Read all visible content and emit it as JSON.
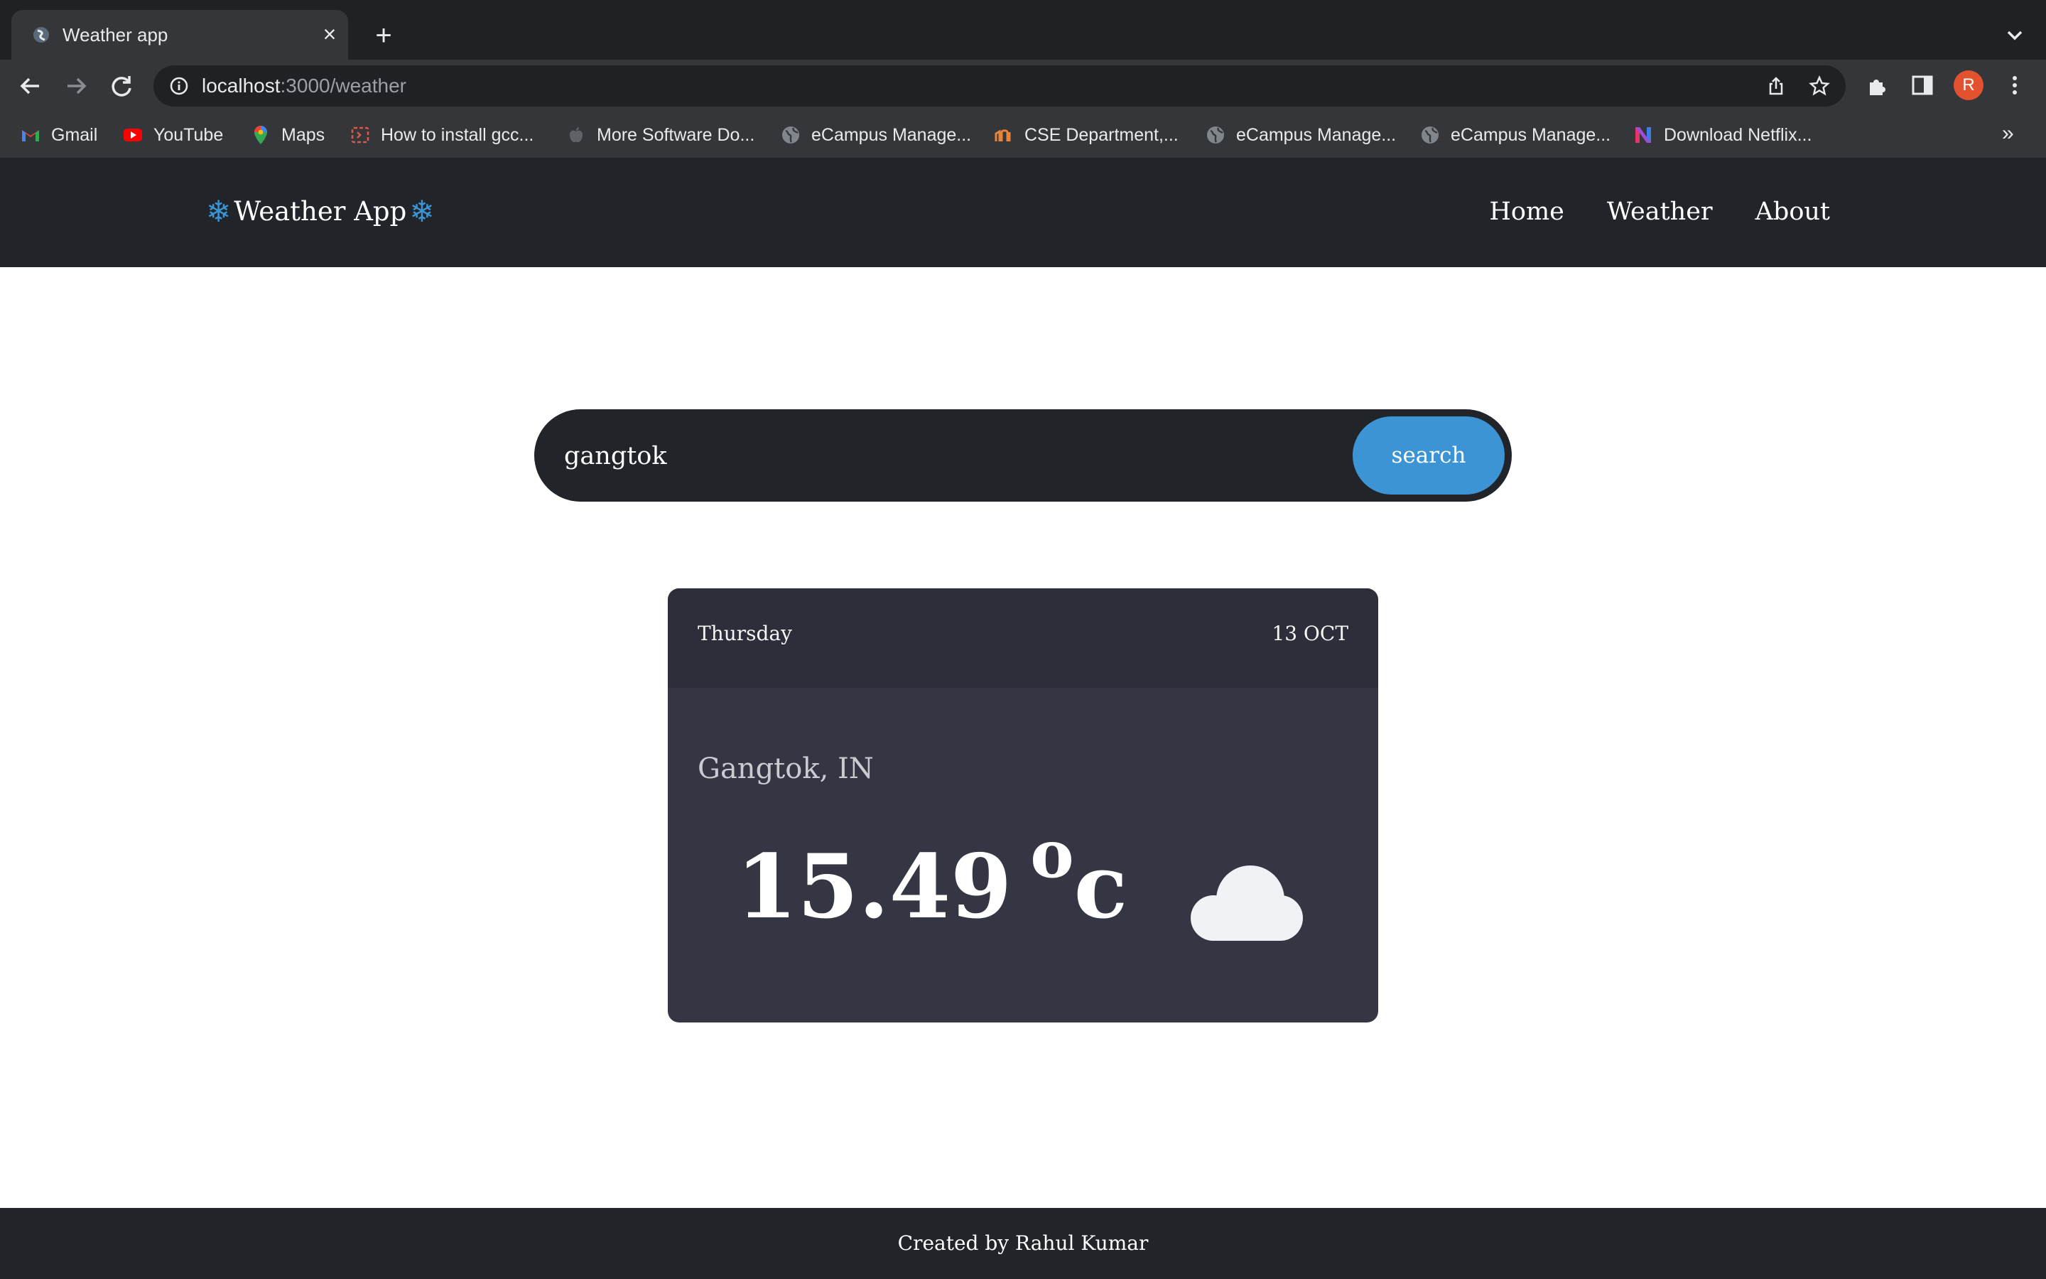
{
  "browser": {
    "tab_title": "Weather app",
    "url_host": "localhost",
    "url_path": ":3000/weather",
    "profile_initial": "R",
    "bookmarks": [
      {
        "label": "Gmail",
        "icon": "gmail-icon"
      },
      {
        "label": "YouTube",
        "icon": "youtube-icon"
      },
      {
        "label": "Maps",
        "icon": "maps-icon"
      },
      {
        "label": "How to install gcc...",
        "icon": "page-icon"
      },
      {
        "label": "More Software Do...",
        "icon": "apple-icon"
      },
      {
        "label": "eCampus Manage...",
        "icon": "globe-icon"
      },
      {
        "label": "CSE Department,...",
        "icon": "site-icon"
      },
      {
        "label": "eCampus Manage...",
        "icon": "globe-icon"
      },
      {
        "label": "eCampus Manage...",
        "icon": "globe-icon"
      },
      {
        "label": "Download Netflix...",
        "icon": "netflix-icon"
      }
    ],
    "bookmarks_overflow": "»"
  },
  "site": {
    "brand_prefix": "❄",
    "brand": "Weather App",
    "brand_suffix": "❄",
    "nav": [
      "Home",
      "Weather",
      "About"
    ]
  },
  "search": {
    "value": "gangtok",
    "button_label": "search"
  },
  "weather": {
    "day": "Thursday",
    "date": "13 OCT",
    "city": "Gangtok, IN",
    "temp": "15.49",
    "degree_symbol": "o",
    "unit": "c",
    "condition_icon": "cloud-icon"
  },
  "footer": {
    "text": "Created by Rahul Kumar"
  },
  "colors": {
    "nav_bg": "#212529",
    "accent": "#3d94d4",
    "card_bg": "#343643",
    "card_header_bg": "#2c2e3a"
  }
}
